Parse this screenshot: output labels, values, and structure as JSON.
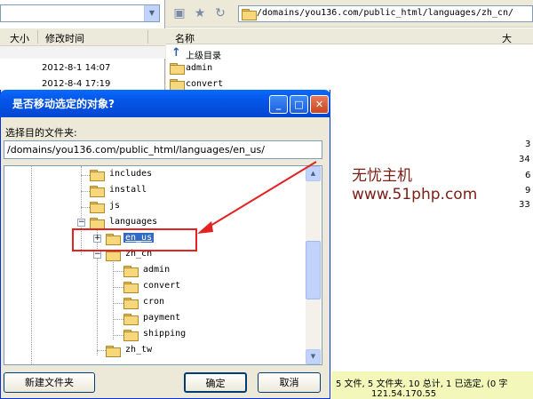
{
  "left_pane": {
    "columns": [
      "大小",
      "修改时间"
    ],
    "rows": [
      {
        "modified": "2012-8-1 14:07"
      },
      {
        "modified": "2012-8-4 17:19"
      }
    ]
  },
  "right_pane": {
    "path": "/domains/you136.com/public_html/languages/zh_cn/",
    "columns": [
      "名称",
      "大"
    ],
    "items": [
      {
        "name": "上级目录"
      },
      {
        "name": "admin"
      },
      {
        "name": "convert"
      }
    ],
    "sizes": [
      "3",
      "34",
      "6",
      "9",
      "33"
    ]
  },
  "watermark": {
    "line1": "无忧主机",
    "line2": "www.51php.com"
  },
  "dialog": {
    "title": "是否移动选定的对象?",
    "label": "选择目的文件夹:",
    "path_value": "/domains/you136.com/public_html/languages/en_us/",
    "tree": [
      {
        "label": "includes"
      },
      {
        "label": "install"
      },
      {
        "label": "js"
      },
      {
        "label": "languages"
      },
      {
        "label": "en_us",
        "selected": true
      },
      {
        "label": "zh_cn"
      },
      {
        "label": "admin"
      },
      {
        "label": "convert"
      },
      {
        "label": "cron"
      },
      {
        "label": "payment"
      },
      {
        "label": "shipping"
      },
      {
        "label": "zh_tw"
      }
    ],
    "buttons": {
      "new_folder": "新建文件夹",
      "ok": "确定",
      "cancel": "取消"
    }
  },
  "status": {
    "line1": "5 文件, 5 文件夹, 10 总计, 1 已选定, (0 字",
    "line2": "121.54.170.55"
  },
  "colors": {
    "title_bar": "#0555e6",
    "selection": "#316ac5",
    "highlight_box": "#e32222",
    "watermark": "#7a1f16",
    "status_bar": "#f3f7b9"
  }
}
